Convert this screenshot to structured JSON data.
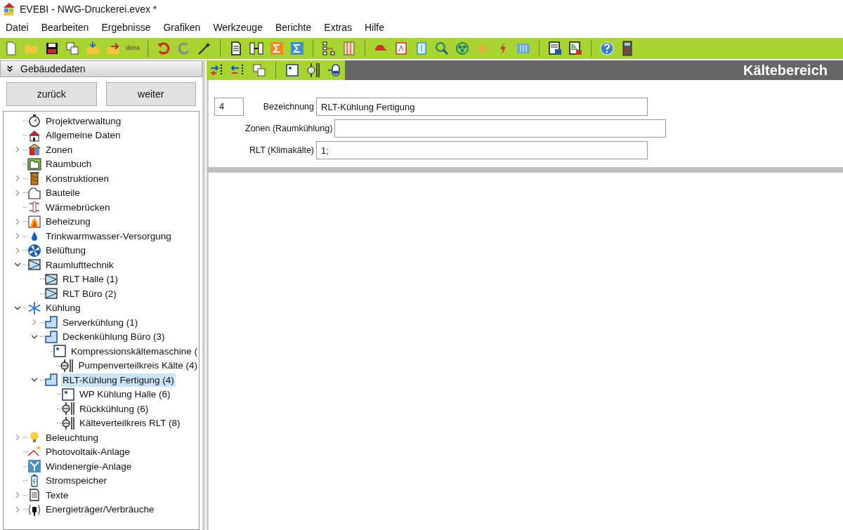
{
  "window": {
    "title": "EVEBI - NWG-Druckerei.evex *"
  },
  "menu": [
    "Datei",
    "Bearbeiten",
    "Ergebnisse",
    "Grafiken",
    "Werkzeuge",
    "Berichte",
    "Extras",
    "Hilfe"
  ],
  "toolbar": {
    "dena_label": "dena"
  },
  "sidebar": {
    "header": "Gebäudedaten",
    "buttons": [
      "zurück",
      "weiter"
    ],
    "tree": [
      {
        "label": "Projektverwaltung",
        "kind": "stopwatch",
        "selected": false
      },
      {
        "label": "Allgemeine Daten",
        "kind": "house",
        "selected": false
      },
      {
        "label": "Zonen",
        "kind": "zones",
        "selected": false,
        "expanded": false
      },
      {
        "label": "Raumbuch",
        "kind": "book",
        "selected": false
      },
      {
        "label": "Konstruktionen",
        "kind": "wall",
        "selected": false,
        "expanded": false
      },
      {
        "label": "Bauteile",
        "kind": "outline",
        "selected": false,
        "expanded": false
      },
      {
        "label": "Wärmebrücken",
        "kind": "bridge",
        "selected": false
      },
      {
        "label": "Beheizung",
        "kind": "flame",
        "selected": false,
        "expanded": false
      },
      {
        "label": "Trinkwarmwasser-Versorgung",
        "kind": "drop",
        "selected": false,
        "expanded": false
      },
      {
        "label": "Belüftung",
        "kind": "fan",
        "selected": false,
        "expanded": false
      },
      {
        "label": "Raumlufttechnik",
        "kind": "rlt",
        "selected": false,
        "expanded": true,
        "children": [
          {
            "label": "RLT Halle (1)",
            "kind": "rlt",
            "selected": false
          },
          {
            "label": "RLT Büro (2)",
            "kind": "rlt",
            "selected": false
          }
        ]
      },
      {
        "label": "Kühlung",
        "kind": "snowflake",
        "selected": false,
        "expanded": true,
        "children": [
          {
            "label": "Serverkühlung (1)",
            "kind": "step",
            "selected": false,
            "expanded": false
          },
          {
            "label": "Deckenkühlung Büro (3)",
            "kind": "step",
            "selected": false,
            "expanded": true,
            "children": [
              {
                "label": "Kompressionskältemaschine (",
                "kind": "compressor",
                "selected": false
              },
              {
                "label": "Pumpenverteilkreis Kälte (4)",
                "kind": "pump",
                "selected": false
              }
            ]
          },
          {
            "label": "RLT-Kühlung Fertigung (4)",
            "kind": "step",
            "selected": true,
            "expanded": true,
            "children": [
              {
                "label": "WP Kühlung Halle (6)",
                "kind": "compressor",
                "selected": false
              },
              {
                "label": "Rückkühlung (6)",
                "kind": "pump",
                "selected": false
              },
              {
                "label": "Kälteverteilkreis RLT (8)",
                "kind": "pump",
                "selected": false
              }
            ]
          }
        ]
      },
      {
        "label": "Beleuchtung",
        "kind": "bulb",
        "selected": false,
        "expanded": false
      },
      {
        "label": "Photovoltaik-Anlage",
        "kind": "pv",
        "selected": false
      },
      {
        "label": "Windenergie-Anlage",
        "kind": "wind",
        "selected": false
      },
      {
        "label": "Stromspeicher",
        "kind": "battery",
        "selected": false
      },
      {
        "label": "Texte",
        "kind": "document",
        "selected": false,
        "expanded": false
      },
      {
        "label": "Energieträger/Verbräuche",
        "kind": "plug",
        "selected": false,
        "expanded": false
      }
    ]
  },
  "panel": {
    "title": "Kältebereich",
    "number": "4",
    "fields": [
      {
        "label": "Bezeichnung",
        "value": "RLT-Kühlung Fertigung"
      },
      {
        "label": "Zonen (Raumkühlung)"
      },
      {
        "label": "RLT (Klimakälte)",
        "value": "1;"
      }
    ]
  }
}
